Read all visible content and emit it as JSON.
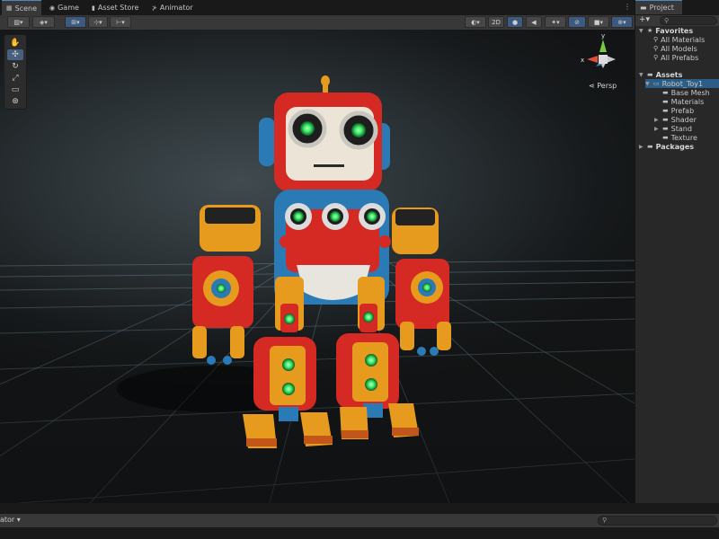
{
  "scene_tabs": [
    {
      "label": "Scene",
      "icon": "scene-icon",
      "glyph": "▦"
    },
    {
      "label": "Game",
      "icon": "gamepad-icon",
      "glyph": "◉"
    },
    {
      "label": "Asset Store",
      "icon": "store-icon",
      "glyph": "▮"
    },
    {
      "label": "Animator",
      "icon": "animator-icon",
      "glyph": "⊁"
    }
  ],
  "toolbar": {
    "label_2d": "2D"
  },
  "gizmo": {
    "persp_label": "Persp",
    "axes": {
      "x": "x",
      "y": "y",
      "z": "z"
    }
  },
  "tools": [
    "hand-tool",
    "move-tool",
    "rotate-tool",
    "scale-tool",
    "rect-tool",
    "transform-tool"
  ],
  "project": {
    "tab_label": "Project",
    "search_placeholder": "",
    "favorites": {
      "label": "Favorites",
      "items": [
        "All Materials",
        "All Models",
        "All Prefabs"
      ]
    },
    "assets": {
      "label": "Assets",
      "selected": "Robot_Toy1",
      "children": [
        "Base Mesh",
        "Materials",
        "Prefab",
        "Shader",
        "Stand",
        "Texture"
      ]
    },
    "packages_label": "Packages"
  },
  "bottom": {
    "cut_label": "ator ▾"
  },
  "colors": {
    "accent": "#4a86c8",
    "selection": "#2c5d87",
    "robot_red": "#d42a23",
    "robot_orange": "#e69a1e",
    "robot_blue": "#2a7bb5",
    "glow_green": "#3ef06a"
  }
}
